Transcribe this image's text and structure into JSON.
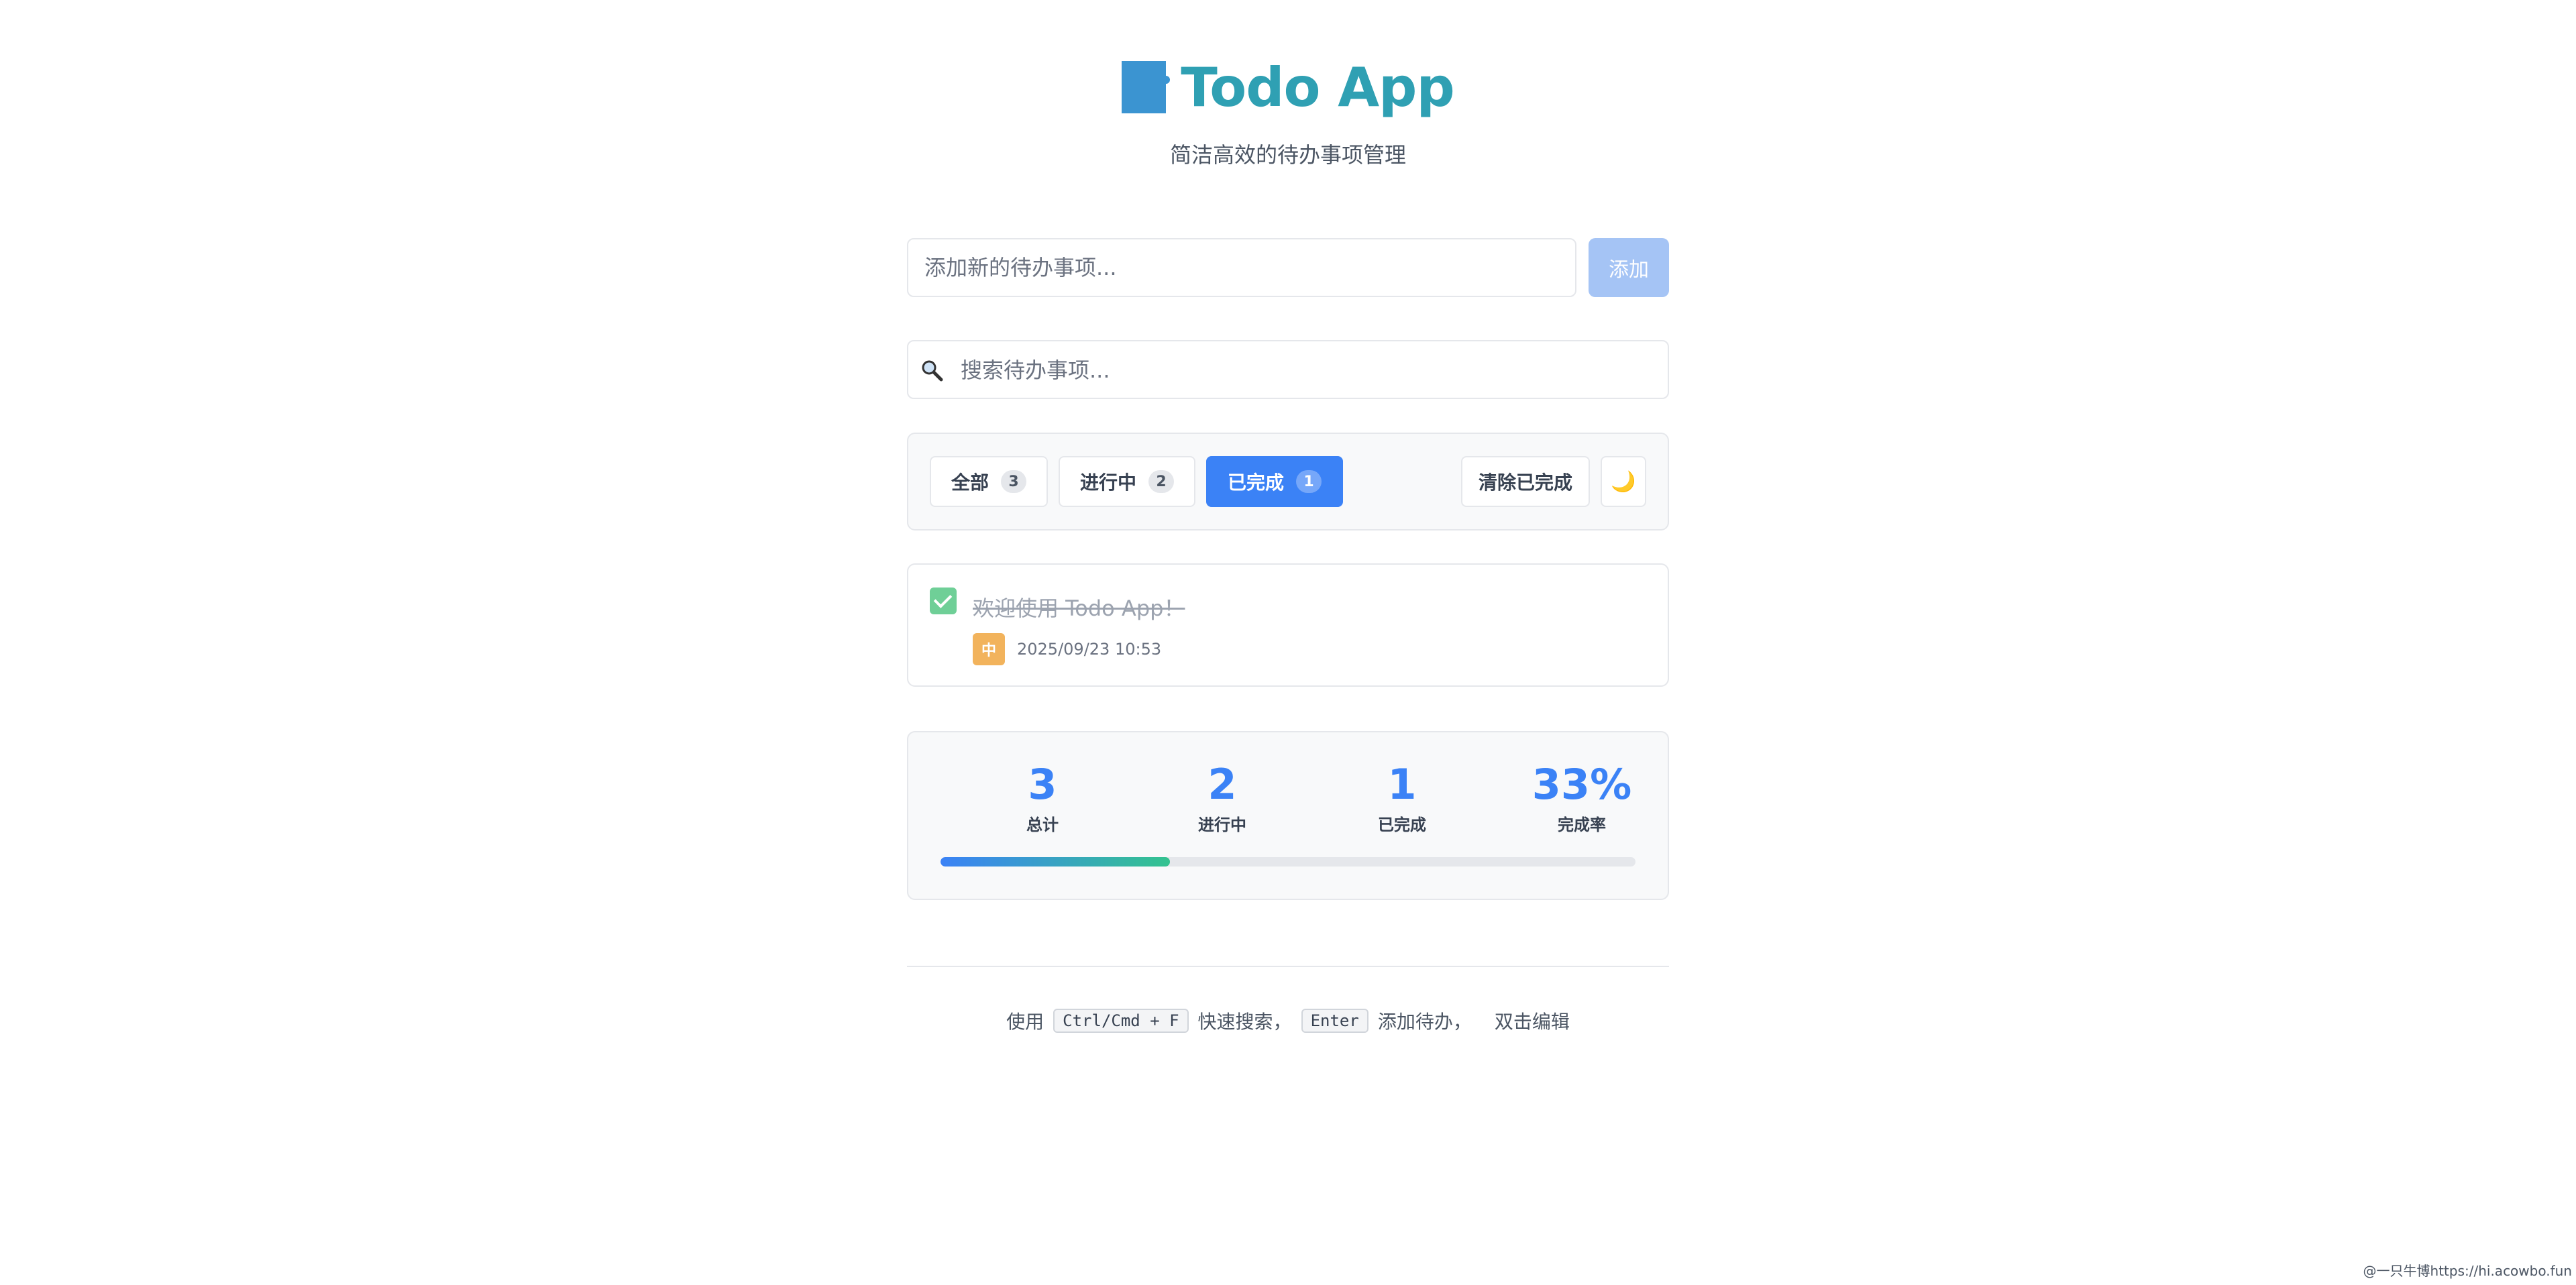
{
  "header": {
    "title": "Todo App",
    "subtitle": "简洁高效的待办事项管理",
    "logo_icon": "square-logo-icon"
  },
  "add_form": {
    "input_placeholder": "添加新的待办事项...",
    "input_value": "",
    "button_label": "添加"
  },
  "search": {
    "icon": "search-icon",
    "placeholder": "搜索待办事项...",
    "value": ""
  },
  "filters": [
    {
      "label": "全部",
      "count": "3",
      "active": false
    },
    {
      "label": "进行中",
      "count": "2",
      "active": false
    },
    {
      "label": "已完成",
      "count": "1",
      "active": true
    }
  ],
  "actions": {
    "clear_completed_label": "清除已完成",
    "theme_toggle_icon": "moon-icon",
    "theme_toggle_glyph": "🌙"
  },
  "todos": [
    {
      "text": "欢迎使用 Todo App！",
      "completed": true,
      "priority": "中",
      "timestamp": "2025/09/23 10:53"
    }
  ],
  "stats": {
    "total_value": "3",
    "total_label": "总计",
    "active_value": "2",
    "active_label": "进行中",
    "completed_value": "1",
    "completed_label": "已完成",
    "rate_value": "33%",
    "rate_label": "完成率",
    "progress_fraction": 0.33
  },
  "footer": {
    "prefix": "使用",
    "shortcut_search": "Ctrl/Cmd + F",
    "search_text": "快速搜索，",
    "shortcut_add": "Enter",
    "add_text": "添加待办，",
    "edit_text": "双击编辑"
  },
  "watermark": "@一只牛博https://hi.acowbo.fun",
  "colors": {
    "title": "#2fa0b3",
    "primary": "#3b82f6",
    "add_button_disabled": "#a5c4f5",
    "checkbox_done": "#6fcf97",
    "priority_medium": "#f2b35c",
    "progress_end": "#34c38f"
  }
}
